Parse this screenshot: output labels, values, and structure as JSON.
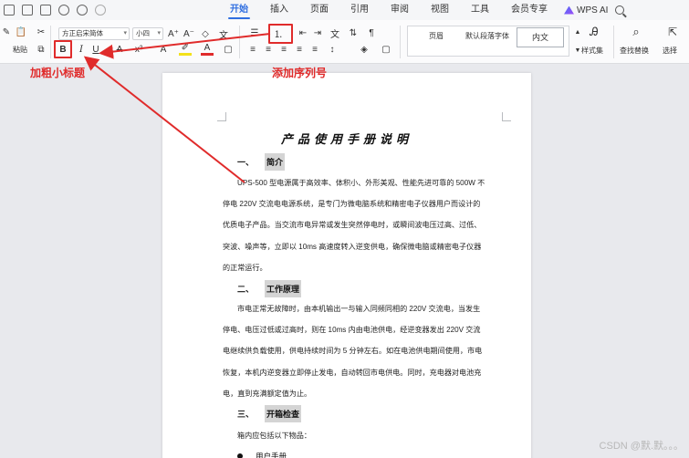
{
  "menu": {
    "tabs": [
      "开始",
      "插入",
      "页面",
      "引用",
      "审阅",
      "视图",
      "工具",
      "会员专享"
    ],
    "active_tab": "开始",
    "ai_label": "WPS AI"
  },
  "ribbon": {
    "cut_label": "粘贴",
    "font_family": "方正启宋简体",
    "font_size": "小四",
    "bold": "B",
    "italic": "I",
    "underline": "U",
    "strikethrough": "A",
    "styles": {
      "body": "页眉",
      "default": "默认段落字体",
      "normal": "内文"
    },
    "styles_set_label": "样式集",
    "find_replace_label": "查找替换",
    "select_label": "选择"
  },
  "annotations": {
    "bold_tip": "加粗小标题",
    "list_tip": "添加序列号"
  },
  "document": {
    "title": "产品使用手册说明",
    "sections": [
      {
        "num": "一、",
        "heading": "简介",
        "lines": [
          "UPS-500 型电源属于高效率、体积小、外形美观、性能先进可靠的 500W 不",
          "停电 220V 交流电电源系统，是专门为微电脑系统和精密电子仪器用户而设计的",
          "优质电子产品。当交流市电异常或发生突然停电时，或瞬间波电压过高、过低、",
          "突波、噪声等，立即以 10ms 高速度转入逆变供电，确保微电脑或精密电子仪器",
          "的正常运行。"
        ]
      },
      {
        "num": "二、",
        "heading": "工作原理",
        "lines": [
          "市电正常无故障时，由本机输出一与输入同频同相的 220V 交流电，当发生",
          "停电、电压过低或过高时，则在 10ms 内由电池供电，经逆变器发出 220V 交流",
          "电继续供负载使用，供电持续时间为 5 分钟左右。如在电池供电期间使用，市电",
          "恢复，本机内逆变器立即停止发电，自动转回市电供电。同时，充电器对电池充",
          "电，直到充满额定值为止。"
        ]
      },
      {
        "num": "三、",
        "heading": "开箱检查",
        "lines": [
          "箱内应包括以下物品："
        ]
      }
    ],
    "bullet_item": "用户手册"
  },
  "watermark": "CSDN @默.默。。。"
}
